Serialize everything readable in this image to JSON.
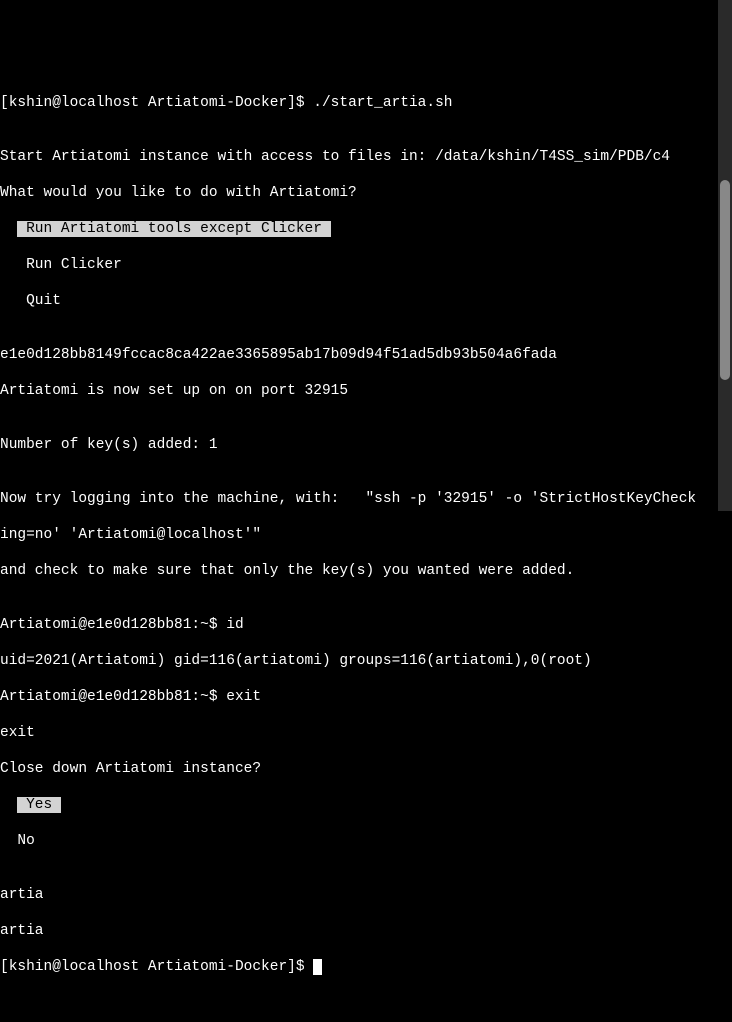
{
  "prompt1": "[kshin@localhost Artiatomi-Docker]$ ",
  "cmd1": "./start_artia.sh",
  "blank": "",
  "start_msg": "Start Artiatomi instance with access to files in: /data/kshin/T4SS_sim/PDB/c4",
  "question1": "What would you like to do with Artiatomi?",
  "menu1_sel": " Run Artiatomi tools except Clicker ",
  "menu1_opt2": "   Run Clicker",
  "menu1_opt3": "   Quit",
  "hash": "e1e0d128bb8149fccac8ca422ae3365895ab17b09d94f51ad5db93b504a6fada",
  "setup_msg": "Artiatomi is now set up on on port 32915",
  "keys_added": "Number of key(s) added: 1",
  "try_login1": "Now try logging into the machine, with:   \"ssh -p '32915' -o 'StrictHostKeyCheck",
  "try_login2": "ing=no' 'Artiatomi@localhost'\"",
  "check_msg": "and check to make sure that only the key(s) you wanted were added.",
  "inner_prompt1": "Artiatomi@e1e0d128bb81:~$ ",
  "inner_cmd1": "id",
  "id_output": "uid=2021(Artiatomi) gid=116(artiatomi) groups=116(artiatomi),0(root)",
  "inner_prompt2": "Artiatomi@e1e0d128bb81:~$ ",
  "inner_cmd2": "exit",
  "exit_echo": "exit",
  "close_q": "Close down Artiatomi instance?",
  "menu2_sel": " Yes ",
  "menu2_opt2": "  No",
  "artia1": "artia",
  "artia2": "artia",
  "prompt2": "[kshin@localhost Artiatomi-Docker]$ "
}
